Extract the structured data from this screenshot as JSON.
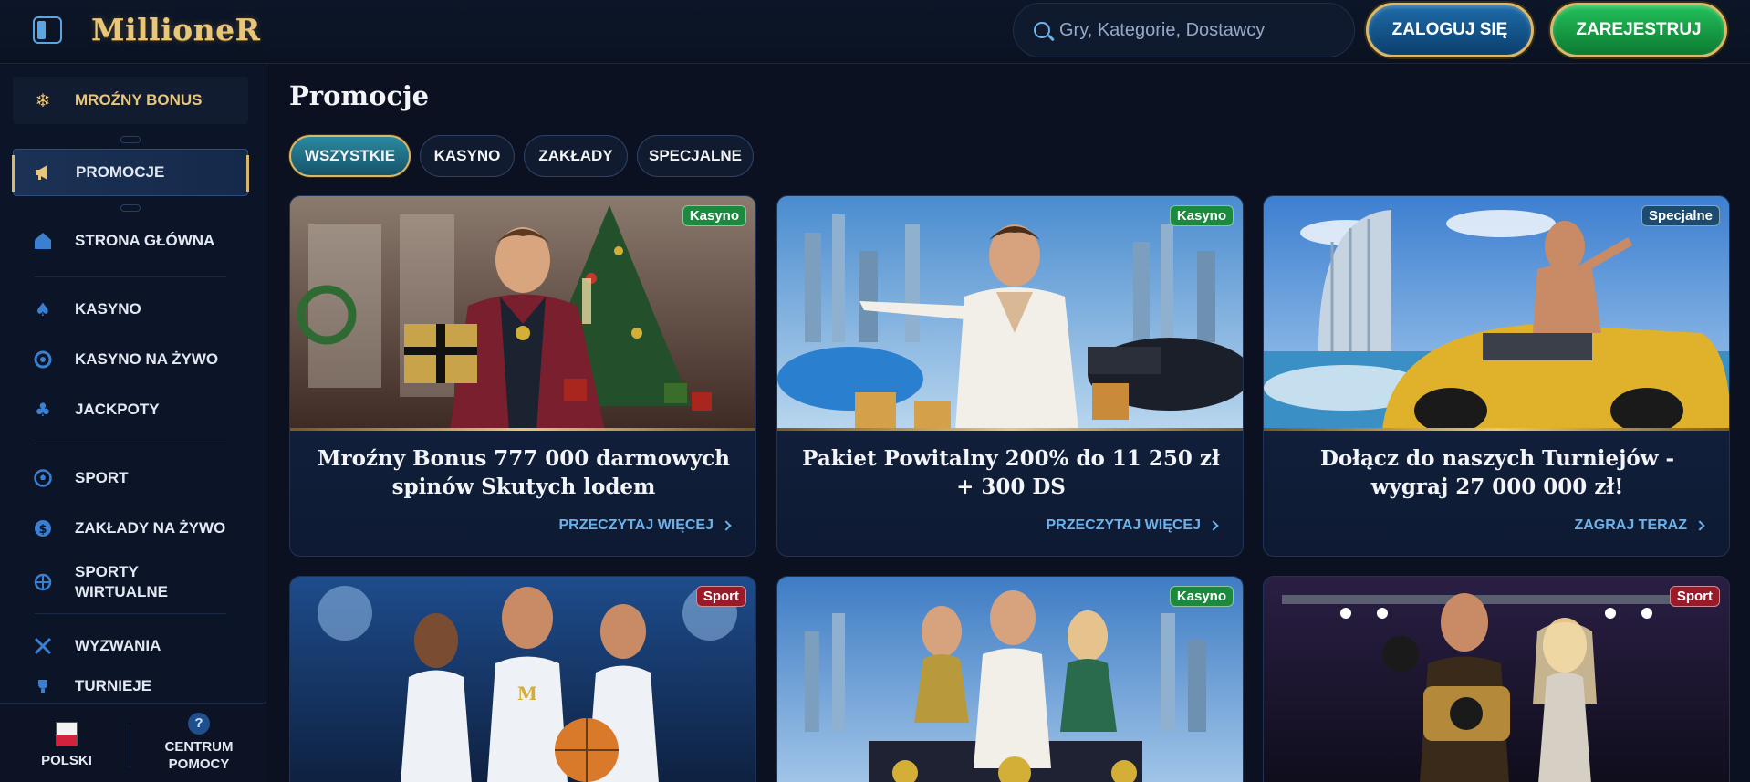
{
  "header": {
    "logo": "MillioneR",
    "search_placeholder": "Gry, Kategorie, Dostawcy",
    "login_label": "ZALOGUJ SIĘ",
    "register_label": "ZAREJESTRUJ"
  },
  "sidebar": {
    "items": [
      {
        "label": "MROŹNY BONUS",
        "icon": "snowflake-icon"
      },
      {
        "label": "PROMOCJE",
        "icon": "megaphone-icon"
      },
      {
        "label": "STRONA GŁÓWNA",
        "icon": "home-icon"
      },
      {
        "label": "KASYNO",
        "icon": "spade-icon"
      },
      {
        "label": "KASYNO NA ŻYWO",
        "icon": "chip-icon"
      },
      {
        "label": "JACKPOTY",
        "icon": "clover-icon"
      },
      {
        "label": "SPORT",
        "icon": "football-icon"
      },
      {
        "label": "ZAKŁADY NA ŻYWO",
        "icon": "live-bet-icon"
      },
      {
        "label": "SPORTY WIRTUALNE",
        "icon": "virtual-sport-icon"
      },
      {
        "label": "WYZWANIA",
        "icon": "swords-icon"
      },
      {
        "label": "TURNIEJE",
        "icon": "trophy-icon"
      }
    ],
    "footer": {
      "language": "POLSKI",
      "help": "CENTRUM POMOCY",
      "help_icon_glyph": "?"
    }
  },
  "main": {
    "title": "Promocje",
    "filters": [
      "WSZYSTKIE",
      "KASYNO",
      "ZAKŁADY",
      "SPECJALNE"
    ],
    "active_filter": "WSZYSTKIE",
    "cards": [
      {
        "badge": "Kasyno",
        "title": "Mroźny Bonus 777 000 darmowych spinów Skutych lodem",
        "link": "PRZECZYTAJ WIĘCEJ"
      },
      {
        "badge": "Kasyno",
        "title": "Pakiet Powitalny 200% do 11 250 zł + 300 DS",
        "link": "PRZECZYTAJ WIĘCEJ"
      },
      {
        "badge": "Specjalne",
        "title": "Dołącz do naszych Turniejów - wygraj 27 000 000 zł!",
        "link": "ZAGRAJ TERAZ"
      },
      {
        "badge": "Sport"
      },
      {
        "badge": "Kasyno"
      },
      {
        "badge": "Sport"
      }
    ]
  },
  "colors": {
    "background": "#0b1120",
    "gold": "#e8c77a",
    "accent_blue": "#6cb2ea",
    "badge_kasyno": "#1b8a3e",
    "badge_specjalne": "#1b4b6e",
    "badge_sport": "#9b1a2a"
  }
}
